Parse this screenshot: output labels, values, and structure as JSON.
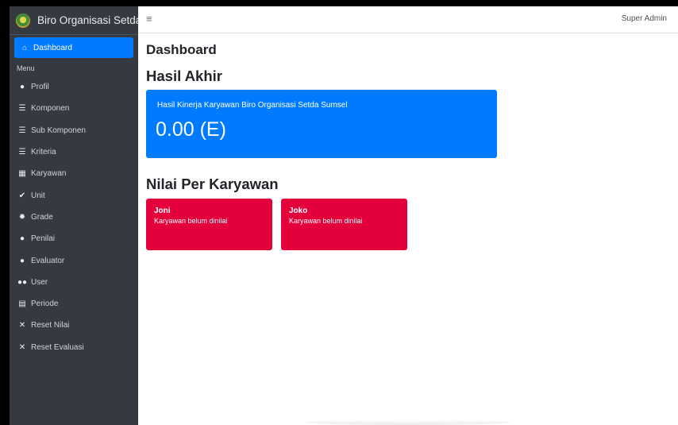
{
  "app": {
    "brand": "Biro Organisasi Setda Sumsel"
  },
  "topbar": {
    "menu_icon": "hamburger-icon",
    "user": "Super Admin"
  },
  "sidebar": {
    "active_item": {
      "label": "Dashboard",
      "icon": "home-icon"
    },
    "menu_header": "Menu",
    "items": [
      {
        "label": "Profil",
        "icon": "user-icon"
      },
      {
        "label": "Komponen",
        "icon": "list-icon"
      },
      {
        "label": "Sub Komponen",
        "icon": "list-icon"
      },
      {
        "label": "Kriteria",
        "icon": "list-icon"
      },
      {
        "label": "Karyawan",
        "icon": "building-icon"
      },
      {
        "label": "Unit",
        "icon": "check-icon"
      },
      {
        "label": "Grade",
        "icon": "gear-icon"
      },
      {
        "label": "Penilai",
        "icon": "user-icon"
      },
      {
        "label": "Evaluator",
        "icon": "user-icon"
      },
      {
        "label": "User",
        "icon": "users-icon"
      },
      {
        "label": "Periode",
        "icon": "calendar-icon"
      },
      {
        "label": "Reset Nilai",
        "icon": "close-icon"
      },
      {
        "label": "Reset Evaluasi",
        "icon": "close-icon"
      }
    ]
  },
  "main": {
    "page_title": "Dashboard",
    "result": {
      "title": "Hasil Akhir",
      "caption": "Hasil Kinerja Karyawan Biro Organisasi Setda Sumsel",
      "value": "0.00 (E)",
      "color": "#007bff"
    },
    "employees": {
      "title": "Nilai Per Karyawan",
      "color": "#e4003a",
      "cards": [
        {
          "name": "Joni",
          "status": "Karyawan belum dinilai"
        },
        {
          "name": "Joko",
          "status": "Karyawan belum dinilai"
        }
      ]
    }
  }
}
